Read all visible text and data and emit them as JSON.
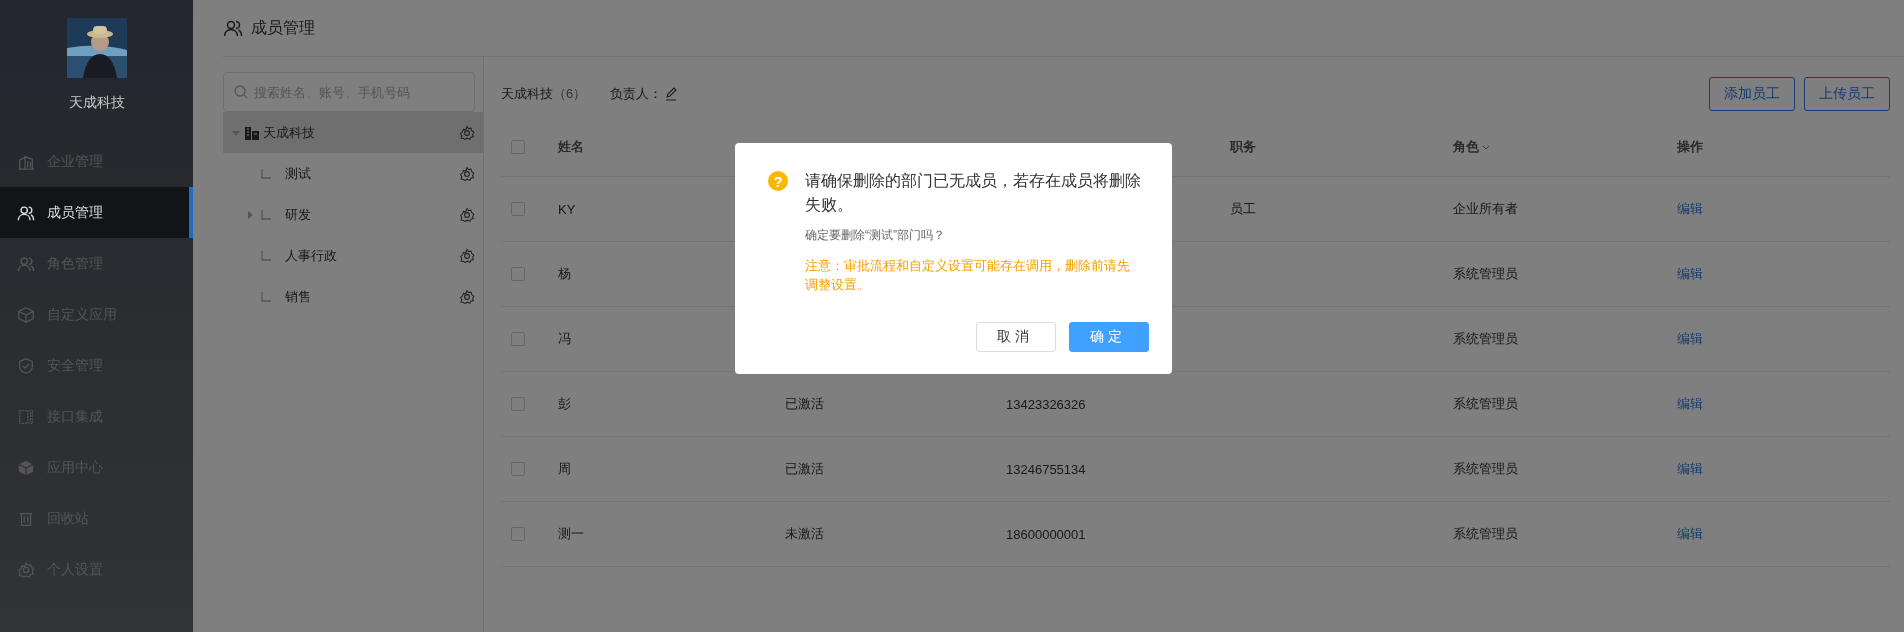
{
  "sidebar": {
    "company": "天成科技",
    "items": [
      {
        "label": "企业管理",
        "selected": false
      },
      {
        "label": "成员管理",
        "selected": true
      },
      {
        "label": "角色管理",
        "selected": false
      },
      {
        "label": "自定义应用",
        "selected": false
      },
      {
        "label": "安全管理",
        "selected": false
      },
      {
        "label": "接口集成",
        "selected": false
      },
      {
        "label": "应用中心",
        "selected": false
      },
      {
        "label": "回收站",
        "selected": false
      },
      {
        "label": "个人设置",
        "selected": false
      }
    ]
  },
  "page_title": "成员管理",
  "search": {
    "placeholder": "搜索姓名、账号、手机号码"
  },
  "tree": [
    {
      "label": "天成科技",
      "kind": "group",
      "expanded": true,
      "selected": true,
      "children": [
        {
          "label": "测试",
          "kind": "leaf",
          "selected": false
        },
        {
          "label": "研发",
          "kind": "group",
          "expanded": false,
          "selected": false
        },
        {
          "label": "人事行政",
          "kind": "leaf",
          "selected": false
        },
        {
          "label": "销售",
          "kind": "leaf",
          "selected": false
        }
      ]
    }
  ],
  "department": {
    "name": "天成科技",
    "count": "（6）",
    "owner_label": "负责人："
  },
  "buttons": [
    "添加员工",
    "上传员工"
  ],
  "table": {
    "header_checked": false,
    "columns": [
      {
        "label": "姓名",
        "sortable": false
      },
      {
        "label": "职务",
        "sortable": false
      },
      {
        "label": "角色",
        "sortable": true
      },
      {
        "label": "操作",
        "sortable": false
      }
    ],
    "rows": [
      {
        "checked": false,
        "name": "KY",
        "title": "员工",
        "role": "企业所有者",
        "action": "编辑"
      },
      {
        "checked": false,
        "name": "杨",
        "role": "系统管理员",
        "action": "编辑"
      },
      {
        "checked": false,
        "name": "冯",
        "role": "系统管理员",
        "action": "编辑"
      },
      {
        "checked": false,
        "name": "彭",
        "status": "已激活",
        "phone": "13423326326",
        "role": "系统管理员",
        "action": "编辑"
      },
      {
        "checked": false,
        "name": "周",
        "status": "已激活",
        "phone": "13246755134",
        "role": "系统管理员",
        "action": "编辑"
      },
      {
        "checked": false,
        "name": "测一",
        "status": "未激活",
        "phone": "18600000001",
        "role": "系统管理员",
        "action": "编辑"
      }
    ]
  },
  "dialog": {
    "icon": "?",
    "message": "请确保删除的部门已无成员，若存在成员将删除失败。",
    "question": "确定要删除“测试”部门吗？",
    "warning": "注意：审批流程和自定义设置可能存在调用，删除前请先调整设置。",
    "cancel": "取消",
    "confirm": "确定"
  }
}
